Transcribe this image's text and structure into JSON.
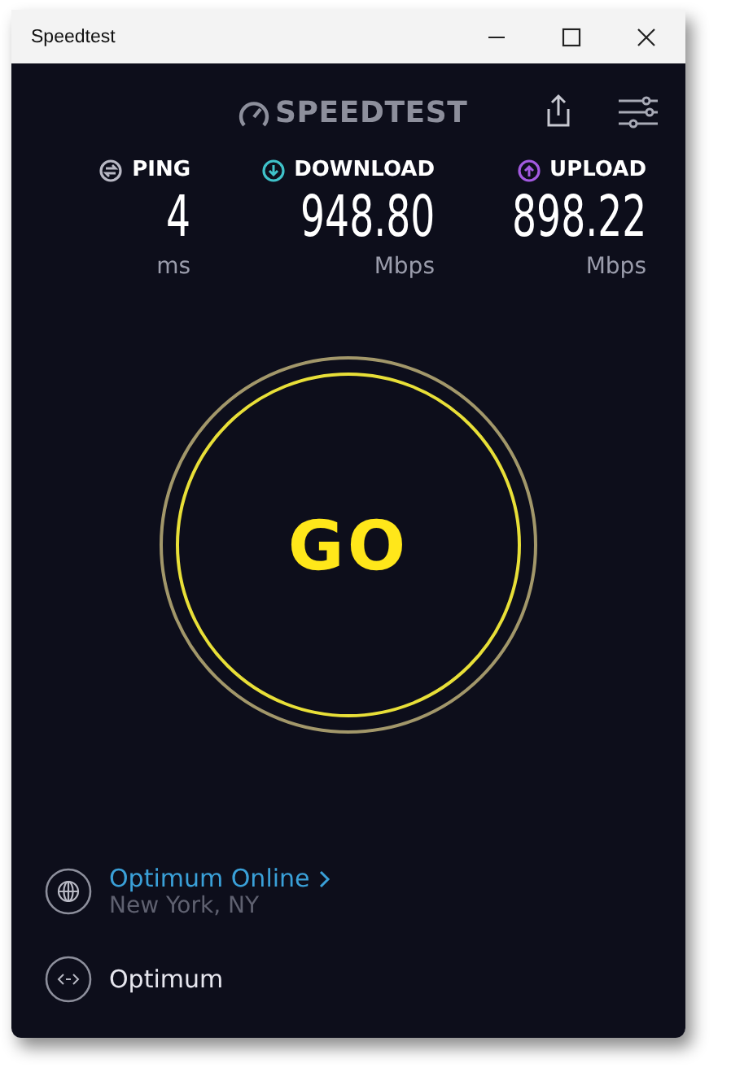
{
  "window": {
    "title": "Speedtest"
  },
  "header": {
    "logo": "SPEEDTEST"
  },
  "metrics": [
    {
      "kind": "ping",
      "label": "PING",
      "value": "4",
      "unit": "ms",
      "color": "#b8b8c4"
    },
    {
      "kind": "download",
      "label": "DOWNLOAD",
      "value": "948.80",
      "unit": "Mbps",
      "color": "#3fc1c9"
    },
    {
      "kind": "upload",
      "label": "UPLOAD",
      "value": "898.22",
      "unit": "Mbps",
      "color": "#a35ae0"
    }
  ],
  "go_button": {
    "label": "GO"
  },
  "connection": {
    "provider": "Optimum Online",
    "location": "New York, NY",
    "server": "Optimum"
  }
}
